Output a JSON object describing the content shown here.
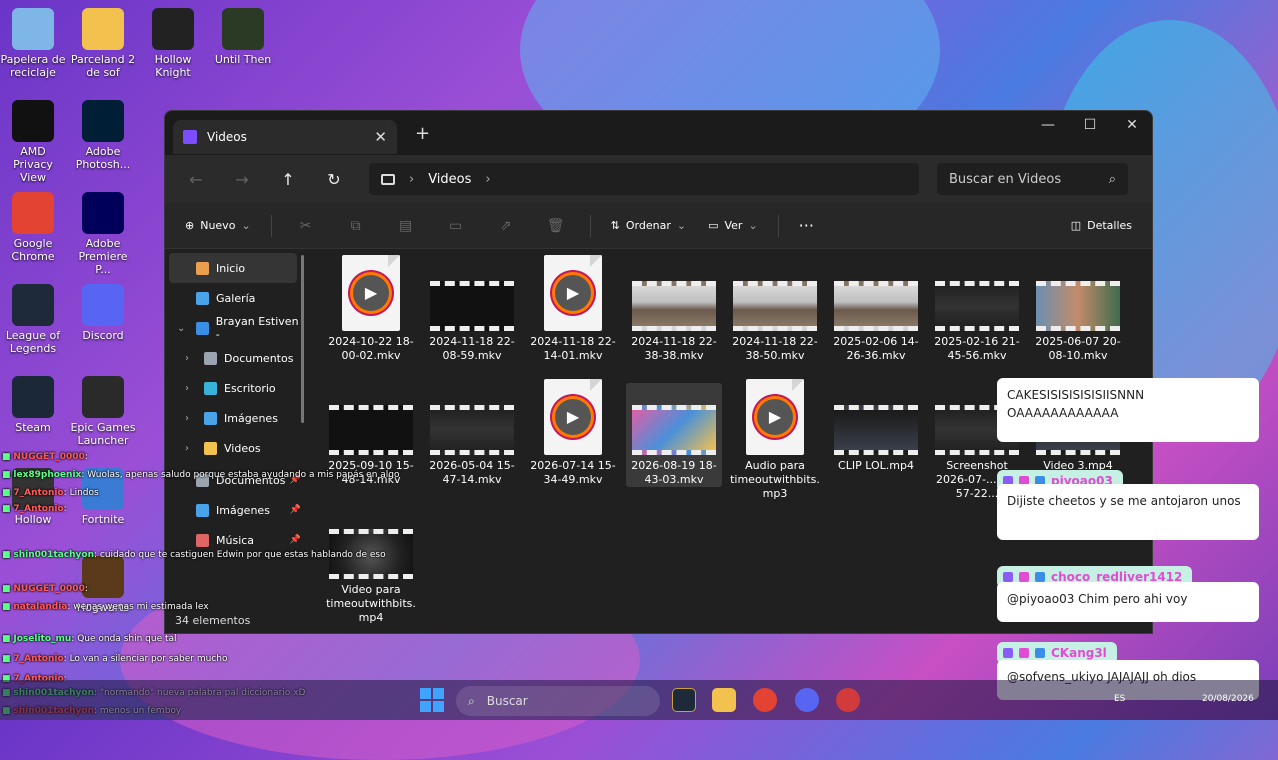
{
  "desktop_icons": [
    {
      "label": "Papelera de reciclaje",
      "icon": "recycle-bin-icon",
      "color": "#7fb6e8"
    },
    {
      "label": "Parceland 2 de sof",
      "icon": "folder-icon",
      "color": "#f2c14e"
    },
    {
      "label": "Hollow Knight",
      "icon": "game-icon",
      "color": "#222222"
    },
    {
      "label": "Until Then",
      "icon": "game-icon",
      "color": "#2a3a24"
    },
    {
      "label": "AMD Privacy View",
      "icon": "amd-icon",
      "color": "#111111"
    },
    {
      "label": "Adobe Photosh...",
      "icon": "photoshop-icon",
      "color": "#001e36"
    },
    {
      "label": "Google Chrome",
      "icon": "chrome-icon",
      "color": "#e24333"
    },
    {
      "label": "Adobe Premiere P...",
      "icon": "premiere-icon",
      "color": "#00005b"
    },
    {
      "label": "League of Legends",
      "icon": "league-icon",
      "color": "#1e2a3a"
    },
    {
      "label": "Discord",
      "icon": "discord-icon",
      "color": "#5865f2"
    },
    {
      "label": "Steam",
      "icon": "steam-icon",
      "color": "#1b2838"
    },
    {
      "label": "Epic Games Launcher",
      "icon": "epic-icon",
      "color": "#2a2a2a"
    },
    {
      "label": "Fortnite",
      "icon": "fortnite-icon",
      "color": "#3a7bd5"
    },
    {
      "label": "Hollow",
      "icon": "game-icon",
      "color": "#333333"
    },
    {
      "label": "Hogwarts",
      "icon": "game-icon",
      "color": "#5a3a1a"
    }
  ],
  "window": {
    "tab_title": "Videos",
    "tab_close": "✕",
    "tab_add": "+",
    "minimize": "—",
    "maximize": "☐",
    "close": "✕"
  },
  "address": {
    "back": "←",
    "forward": "→",
    "up": "↑",
    "refresh": "↻",
    "crumb": "Videos",
    "crumb_sep": "›",
    "search_placeholder": "Buscar en Videos"
  },
  "commandbar": {
    "new_label": "Nuevo",
    "sort_label": "Ordenar",
    "view_label": "Ver",
    "more_label": "···",
    "details_label": "Detalles"
  },
  "nav": [
    {
      "label": "Inicio",
      "icon": "home-icon",
      "color": "#e8a04e",
      "selected": true,
      "expandable": false,
      "pinned": false,
      "indent": 0
    },
    {
      "label": "Galería",
      "icon": "gallery-icon",
      "color": "#4aa3e8",
      "selected": false,
      "expandable": false,
      "pinned": false,
      "indent": 0
    },
    {
      "label": "Brayan Estiven -",
      "icon": "onedrive-icon",
      "color": "#3a8ee6",
      "selected": false,
      "expandable": true,
      "pinned": false,
      "indent": 0
    },
    {
      "label": "Documentos",
      "icon": "documents-icon",
      "color": "#9aa5b1",
      "selected": false,
      "expandable": true,
      "pinned": false,
      "indent": 1
    },
    {
      "label": "Escritorio",
      "icon": "desktop-icon",
      "color": "#38b2d6",
      "selected": false,
      "expandable": true,
      "pinned": false,
      "indent": 1
    },
    {
      "label": "Imágenes",
      "icon": "pictures-icon",
      "color": "#4aa3e8",
      "selected": false,
      "expandable": true,
      "pinned": false,
      "indent": 1
    },
    {
      "label": "Videos",
      "icon": "folder-icon",
      "color": "#f2c14e",
      "selected": false,
      "expandable": true,
      "pinned": false,
      "indent": 1
    },
    {
      "label": "Documentos",
      "icon": "documents-icon",
      "color": "#9aa5b1",
      "selected": false,
      "expandable": false,
      "pinned": true,
      "indent": 0
    },
    {
      "label": "Imágenes",
      "icon": "pictures-icon",
      "color": "#4aa3e8",
      "selected": false,
      "expandable": false,
      "pinned": true,
      "indent": 0
    },
    {
      "label": "Música",
      "icon": "music-icon",
      "color": "#e06666",
      "selected": false,
      "expandable": false,
      "pinned": true,
      "indent": 0
    }
  ],
  "files": [
    {
      "name": "2024-10-22 18-00-02.mkv",
      "thumb": "doc"
    },
    {
      "name": "2024-11-18 22-08-59.mkv",
      "thumb": "film"
    },
    {
      "name": "2024-11-18 22-14-01.mkv",
      "thumb": "doc"
    },
    {
      "name": "2024-11-18 22-38-38.mkv",
      "thumb": "film cam"
    },
    {
      "name": "2024-11-18 22-38-50.mkv",
      "thumb": "film cam"
    },
    {
      "name": "2025-02-06 14-26-36.mkv",
      "thumb": "film cam"
    },
    {
      "name": "2025-02-16 21-45-56.mkv",
      "thumb": "film screen"
    },
    {
      "name": "2025-06-07 20-08-10.mkv",
      "thumb": "film game"
    },
    {
      "name": "2025-09-10 15-48-14.mkv",
      "thumb": "film"
    },
    {
      "name": "2026-05-04 15-47-14.mkv",
      "thumb": "film screen"
    },
    {
      "name": "2026-07-14 15-34-49.mkv",
      "thumb": "doc"
    },
    {
      "name": "2026-08-19 18-43-03.mkv",
      "thumb": "film colors"
    },
    {
      "name": "Audio para timeoutwithbits. mp3",
      "thumb": "doc"
    },
    {
      "name": "CLIP LOL.mp4",
      "thumb": "film dark"
    },
    {
      "name": "Screenshot 2026-07-... 18-57-22...",
      "thumb": "film screen"
    },
    {
      "name": "Video 3.mp4",
      "thumb": "film dark"
    },
    {
      "name": "Video para timeoutwithbits. mp4",
      "thumb": "film anime"
    }
  ],
  "status": {
    "count": "34 elementos"
  },
  "chat_overlay": [
    {
      "user": "NUGGET_0000",
      "text": ":"
    },
    {
      "user": "lex89phoenix",
      "text": ": Wuolas, apenas saludo porque estaba ayudando a mis papás en algo"
    },
    {
      "user": "7_Antonio",
      "text": ": Lindos"
    },
    {
      "user": "7_Antonio",
      "text": ":"
    },
    {
      "user": "shin001tachyon",
      "text": ": cuidado que te castiguen Edwin por que estas hablando de eso"
    },
    {
      "user": "NUGGET_0000",
      "text": ":"
    },
    {
      "user": "natalandia",
      "text": ": wenas wenas mi estimada lex"
    },
    {
      "user": "Joselito_mu",
      "text": ": Que onda shin que tal"
    },
    {
      "user": "7_Antonio",
      "text": ": Lo van a silenciar por saber mucho"
    },
    {
      "user": "7_Antonio",
      "text": ":"
    },
    {
      "user": "shin001tachyon",
      "text": ": \"normando\" nueva palabra pal diccionario xD"
    },
    {
      "user": "shin001tachyon",
      "text": ": menos un femboy"
    }
  ],
  "chat_bubbles": [
    {
      "user": "",
      "text": "CAKESISISISISISIISNNN OAAAAAAAAAAAA"
    },
    {
      "user": "piyoao03",
      "text": "Dijiste cheetos y se me antojaron unos"
    },
    {
      "user": "choco_redliver1412",
      "text": "@piyoao03 Chim pero ahi voy"
    },
    {
      "user": "CKang3l",
      "text": "@sofvens_ukiyo JAJAJAJJ oh dios"
    }
  ],
  "taskbar": {
    "search_label": "Buscar",
    "lang": "ES",
    "date": "20/08/2026"
  }
}
